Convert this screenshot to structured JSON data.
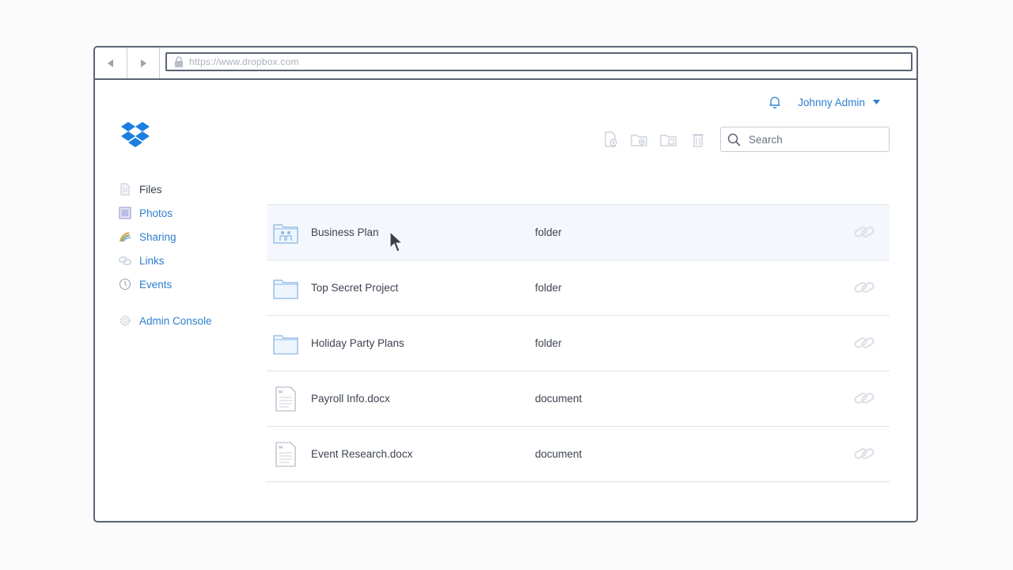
{
  "browser": {
    "url": "https://www.dropbox.com"
  },
  "user": {
    "name": "Johnny Admin"
  },
  "search": {
    "placeholder": "Search"
  },
  "sidebar": {
    "items": [
      {
        "label": "Files",
        "icon": "file-icon"
      },
      {
        "label": "Photos",
        "icon": "photo-icon"
      },
      {
        "label": "Sharing",
        "icon": "sharing-icon"
      },
      {
        "label": "Links",
        "icon": "link-icon"
      },
      {
        "label": "Events",
        "icon": "clock-icon"
      },
      {
        "label": "Admin Console",
        "icon": "gear-icon"
      }
    ]
  },
  "files": [
    {
      "name": "Business Plan",
      "type": "folder",
      "icon": "shared-folder-icon"
    },
    {
      "name": "Top Secret Project",
      "type": "folder",
      "icon": "folder-icon"
    },
    {
      "name": "Holiday Party Plans",
      "type": "folder",
      "icon": "folder-icon"
    },
    {
      "name": "Payroll Info.docx",
      "type": "document",
      "icon": "document-icon"
    },
    {
      "name": "Event Research.docx",
      "type": "document",
      "icon": "document-icon"
    }
  ],
  "colors": {
    "accent": "#2d7fd0",
    "frame": "#5c6475",
    "hover_row": "#f4f8fc"
  }
}
